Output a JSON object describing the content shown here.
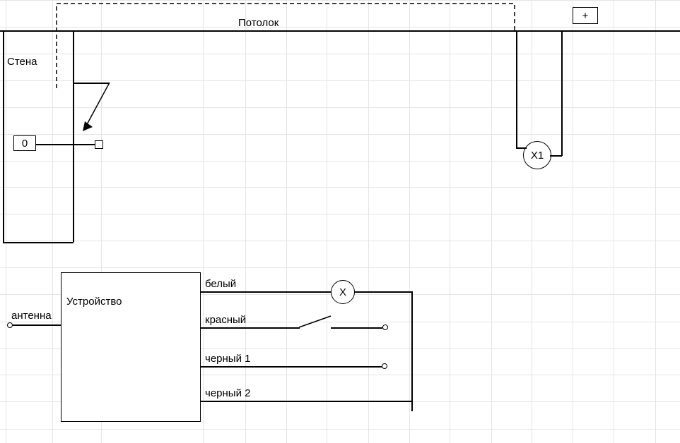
{
  "ceiling_label": "Потолок",
  "wall_label": "Стена",
  "socket_label": "0",
  "lamp_x1_label": "X1",
  "plus_label": "+",
  "device_label": "Устройство",
  "antenna_label": "антенна",
  "wires": {
    "white": "белый",
    "red": "красный",
    "black1": "черный 1",
    "black2": "черный 2"
  },
  "lamp_x_label": "X",
  "grid": {
    "verticals": [
      8,
      74,
      143,
      287,
      347,
      405,
      462,
      521,
      579,
      636,
      695,
      752,
      810,
      868,
      927
    ],
    "horizontals": [
      0,
      38,
      76,
      114,
      152,
      190,
      228,
      265,
      303,
      341,
      379,
      417,
      456,
      494,
      531,
      569,
      608
    ]
  }
}
